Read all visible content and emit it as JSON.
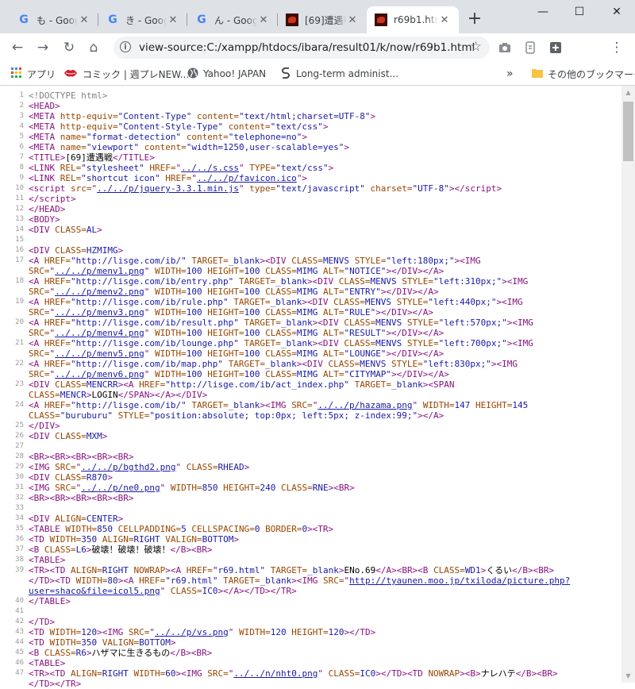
{
  "tabs": [
    {
      "title": "も - Google",
      "icon": "google-icon"
    },
    {
      "title": "き - Google",
      "icon": "google-icon"
    },
    {
      "title": "ん - Google",
      "icon": "google-icon"
    },
    {
      "title": "[69]遭遇戦",
      "icon": "site-favicon-icon"
    },
    {
      "title": "r69b1.html",
      "icon": "site-favicon-icon",
      "active": true
    }
  ],
  "toolbar": {
    "url": "view-source:C:/xampp/htdocs/ibara/result01/k/now/r69b1.html",
    "profile_initial": "S"
  },
  "bookmarks": {
    "items": [
      {
        "label": "アプリ",
        "icon": "apps-grid-icon"
      },
      {
        "label": "コミック | 週プレNEW...",
        "icon": "lips-icon"
      },
      {
        "label": "Yahoo! JAPAN",
        "icon": "globe-icon"
      },
      {
        "label": "Long-term administ...",
        "icon": "script-icon"
      }
    ],
    "other_label": "その他のブックマーク"
  },
  "source_lines": [
    {
      "n": "1",
      "html": "<span class=\"c\">&lt;!DOCTYPE html&gt;</span>"
    },
    {
      "n": "2",
      "html": "<span class=\"t\">&lt;HEAD&gt;</span>"
    },
    {
      "n": "3",
      "html": "<span class=\"t\">&lt;META <span class=\"a\">http-equiv=</span><span class=\"v\">\"Content-Type\"</span> <span class=\"a\">content=</span><span class=\"v\">\"text/html;charset=UTF-8\"</span>&gt;</span>"
    },
    {
      "n": "4",
      "html": "<span class=\"t\">&lt;META <span class=\"a\">http-equiv=</span><span class=\"v\">\"Content-Style-Type\"</span> <span class=\"a\">content=</span><span class=\"v\">\"text/css\"</span>&gt;</span>"
    },
    {
      "n": "5",
      "html": "<span class=\"t\">&lt;META <span class=\"a\">name=</span><span class=\"v\">\"format-detection\"</span> <span class=\"a\">content=</span><span class=\"v\">\"telephone=no\"</span>&gt;</span>"
    },
    {
      "n": "6",
      "html": "<span class=\"t\">&lt;META <span class=\"a\">name=</span><span class=\"v\">\"viewport\"</span> <span class=\"a\">content=</span><span class=\"v\">\"width=1250,user-scalable=yes\"</span>&gt;</span>"
    },
    {
      "n": "7",
      "html": "<span class=\"t\">&lt;TITLE&gt;</span>[69]遭遇戦<span class=\"t\">&lt;/TITLE&gt;</span>"
    },
    {
      "n": "8",
      "html": "<span class=\"t\">&lt;LINK <span class=\"a\">REL=</span><span class=\"v\">\"stylesheet\"</span> <span class=\"a\">HREF=</span>\"<span class=\"k\">../../s.css</span>\" <span class=\"a\">TYPE=</span><span class=\"v\">\"text/css\"</span>&gt;</span>"
    },
    {
      "n": "9",
      "html": "<span class=\"t\">&lt;LINK <span class=\"a\">REL=</span><span class=\"v\">\"shortcut icon\"</span> <span class=\"a\">HREF=</span>\"<span class=\"k\">../../p/favicon.ico</span>\"&gt;</span>"
    },
    {
      "n": "10",
      "html": "<span class=\"t\">&lt;script <span class=\"a\">src=</span>\"<span class=\"k\">../../p/jquery-3.3.1.min.js</span>\" <span class=\"a\">type=</span><span class=\"v\">\"text/javascript\"</span> <span class=\"a\">charset=</span><span class=\"v\">\"UTF-8\"</span>&gt;&lt;/script&gt;</span>"
    },
    {
      "n": "11",
      "html": "<span class=\"t\">&lt;/script&gt;</span>"
    },
    {
      "n": "12",
      "html": "<span class=\"t\">&lt;/HEAD&gt;</span>"
    },
    {
      "n": "13",
      "html": "<span class=\"t\">&lt;BODY&gt;</span>"
    },
    {
      "n": "14",
      "html": "<span class=\"t\">&lt;DIV <span class=\"a\">CLASS=</span><span class=\"v\">AL</span>&gt;</span>"
    },
    {
      "n": "15",
      "html": ""
    },
    {
      "n": "16",
      "html": "<span class=\"t\">&lt;DIV <span class=\"a\">CLASS=</span><span class=\"v\">HZMIMG</span>&gt;</span>"
    },
    {
      "n": "17",
      "html": "<span class=\"t\">&lt;A <span class=\"a\">HREF=</span><span class=\"v\">\"http://lisge.com/ib/\"</span> <span class=\"a\">TARGET=</span><span class=\"v\">_blank</span>&gt;&lt;DIV <span class=\"a\">CLASS=</span><span class=\"v\">MENVS</span> <span class=\"a\">STYLE=</span><span class=\"v\">\"left:180px;\"</span>&gt;&lt;IMG</span>"
    },
    {
      "n": "",
      "html": "<span class=\"t\"><span class=\"a\">SRC=</span>\"<span class=\"k\">../../p/menv1.png</span>\" <span class=\"a\">WIDTH=</span><span class=\"v\">100</span> <span class=\"a\">HEIGHT=</span><span class=\"v\">100</span> <span class=\"a\">CLASS=</span><span class=\"v\">MIMG</span> <span class=\"a\">ALT=</span><span class=\"v\">\"NOTICE\"</span>&gt;&lt;/DIV&gt;&lt;/A&gt;</span>"
    },
    {
      "n": "18",
      "html": "<span class=\"t\">&lt;A <span class=\"a\">HREF=</span><span class=\"v\">\"http://lisge.com/ib/entry.php\"</span> <span class=\"a\">TARGET=</span><span class=\"v\">_blank</span>&gt;&lt;DIV <span class=\"a\">CLASS=</span><span class=\"v\">MENVS</span> <span class=\"a\">STYLE=</span><span class=\"v\">\"left:310px;\"</span>&gt;&lt;IMG</span>"
    },
    {
      "n": "",
      "html": "<span class=\"t\"><span class=\"a\">SRC=</span>\"<span class=\"k\">../../p/menv2.png</span>\" <span class=\"a\">WIDTH=</span><span class=\"v\">100</span> <span class=\"a\">HEIGHT=</span><span class=\"v\">100</span> <span class=\"a\">CLASS=</span><span class=\"v\">MIMG</span> <span class=\"a\">ALT=</span><span class=\"v\">\"ENTRY\"</span>&gt;&lt;/DIV&gt;&lt;/A&gt;</span>"
    },
    {
      "n": "19",
      "html": "<span class=\"t\">&lt;A <span class=\"a\">HREF=</span><span class=\"v\">\"http://lisge.com/ib/rule.php\"</span> <span class=\"a\">TARGET=</span><span class=\"v\">_blank</span>&gt;&lt;DIV <span class=\"a\">CLASS=</span><span class=\"v\">MENVS</span> <span class=\"a\">STYLE=</span><span class=\"v\">\"left:440px;\"</span>&gt;&lt;IMG</span>"
    },
    {
      "n": "",
      "html": "<span class=\"t\"><span class=\"a\">SRC=</span>\"<span class=\"k\">../../p/menv3.png</span>\" <span class=\"a\">WIDTH=</span><span class=\"v\">100</span> <span class=\"a\">HEIGHT=</span><span class=\"v\">100</span> <span class=\"a\">CLASS=</span><span class=\"v\">MIMG</span> <span class=\"a\">ALT=</span><span class=\"v\">\"RULE\"</span>&gt;&lt;/DIV&gt;&lt;/A&gt;</span>"
    },
    {
      "n": "20",
      "html": "<span class=\"t\">&lt;A <span class=\"a\">HREF=</span><span class=\"v\">\"http://lisge.com/ib/result.php\"</span> <span class=\"a\">TARGET=</span><span class=\"v\">_blank</span>&gt;&lt;DIV <span class=\"a\">CLASS=</span><span class=\"v\">MENVS</span> <span class=\"a\">STYLE=</span><span class=\"v\">\"left:570px;\"</span>&gt;&lt;IMG</span>"
    },
    {
      "n": "",
      "html": "<span class=\"t\"><span class=\"a\">SRC=</span>\"<span class=\"k\">../../p/menv4.png</span>\" <span class=\"a\">WIDTH=</span><span class=\"v\">100</span> <span class=\"a\">HEIGHT=</span><span class=\"v\">100</span> <span class=\"a\">CLASS=</span><span class=\"v\">MIMG</span> <span class=\"a\">ALT=</span><span class=\"v\">\"RESULT\"</span>&gt;&lt;/DIV&gt;&lt;/A&gt;</span>"
    },
    {
      "n": "21",
      "html": "<span class=\"t\">&lt;A <span class=\"a\">HREF=</span><span class=\"v\">\"http://lisge.com/ib/lounge.php\"</span> <span class=\"a\">TARGET=</span><span class=\"v\">_blank</span>&gt;&lt;DIV <span class=\"a\">CLASS=</span><span class=\"v\">MENVS</span> <span class=\"a\">STYLE=</span><span class=\"v\">\"left:700px;\"</span>&gt;&lt;IMG</span>"
    },
    {
      "n": "",
      "html": "<span class=\"t\"><span class=\"a\">SRC=</span>\"<span class=\"k\">../../p/menv5.png</span>\" <span class=\"a\">WIDTH=</span><span class=\"v\">100</span> <span class=\"a\">HEIGHT=</span><span class=\"v\">100</span> <span class=\"a\">CLASS=</span><span class=\"v\">MIMG</span> <span class=\"a\">ALT=</span><span class=\"v\">\"LOUNGE\"</span>&gt;&lt;/DIV&gt;&lt;/A&gt;</span>"
    },
    {
      "n": "22",
      "html": "<span class=\"t\">&lt;A <span class=\"a\">HREF=</span><span class=\"v\">\"http://lisge.com/ib/map.php\"</span> <span class=\"a\">TARGET=</span><span class=\"v\">_blank</span>&gt;&lt;DIV <span class=\"a\">CLASS=</span><span class=\"v\">MENVS</span> <span class=\"a\">STYLE=</span><span class=\"v\">\"left:830px;\"</span>&gt;&lt;IMG</span>"
    },
    {
      "n": "",
      "html": "<span class=\"t\"><span class=\"a\">SRC=</span>\"<span class=\"k\">../../p/menv6.png</span>\" <span class=\"a\">WIDTH=</span><span class=\"v\">100</span> <span class=\"a\">HEIGHT=</span><span class=\"v\">100</span> <span class=\"a\">CLASS=</span><span class=\"v\">MIMG</span> <span class=\"a\">ALT=</span><span class=\"v\">\"CITYMAP\"</span>&gt;&lt;/DIV&gt;&lt;/A&gt;</span>"
    },
    {
      "n": "23",
      "html": "<span class=\"t\">&lt;DIV <span class=\"a\">CLASS=</span><span class=\"v\">MENCRR</span>&gt;&lt;A <span class=\"a\">HREF=</span><span class=\"v\">\"http://lisge.com/ib/act_index.php\"</span> <span class=\"a\">TARGET=</span><span class=\"v\">_blank</span>&gt;&lt;SPAN</span>"
    },
    {
      "n": "",
      "html": "<span class=\"t\"><span class=\"a\">CLASS=</span><span class=\"v\">MENCR</span>&gt;</span>LOGIN<span class=\"t\">&lt;/SPAN&gt;&lt;/A&gt;&lt;/DIV&gt;</span>"
    },
    {
      "n": "24",
      "html": "<span class=\"t\">&lt;A <span class=\"a\">HREF=</span><span class=\"v\">\"http://lisge.com/ib/\"</span> <span class=\"a\">TARGET=</span><span class=\"v\">_blank</span>&gt;&lt;IMG <span class=\"a\">SRC=</span>\"<span class=\"k\">../../p/hazama.png</span>\" <span class=\"a\">WIDTH=</span><span class=\"v\">147</span> <span class=\"a\">HEIGHT=</span><span class=\"v\">145</span></span>"
    },
    {
      "n": "",
      "html": "<span class=\"t\"><span class=\"a\">CLASS=</span><span class=\"v\">\"buruburu\"</span> <span class=\"a\">STYLE=</span><span class=\"v\">\"position:absolute; top:0px; left:5px; z-index:99;\"</span>&gt;&lt;/A&gt;</span>"
    },
    {
      "n": "25",
      "html": "<span class=\"t\">&lt;/DIV&gt;</span>"
    },
    {
      "n": "26",
      "html": "<span class=\"t\">&lt;DIV <span class=\"a\">CLASS=</span><span class=\"v\">MXM</span>&gt;</span>"
    },
    {
      "n": "27",
      "html": ""
    },
    {
      "n": "28",
      "html": "<span class=\"t\">&lt;BR&gt;&lt;BR&gt;&lt;BR&gt;&lt;BR&gt;&lt;BR&gt;</span>"
    },
    {
      "n": "29",
      "html": "<span class=\"t\">&lt;IMG <span class=\"a\">SRC=</span>\"<span class=\"k\">../../p/bgthd2.png</span>\" <span class=\"a\">CLASS=</span><span class=\"v\">RHEAD</span>&gt;</span>"
    },
    {
      "n": "30",
      "html": "<span class=\"t\">&lt;DIV <span class=\"a\">CLASS=</span><span class=\"v\">R870</span>&gt;</span>"
    },
    {
      "n": "31",
      "html": "<span class=\"t\">&lt;IMG <span class=\"a\">SRC=</span>\"<span class=\"k\">../../p/ne0.png</span>\" <span class=\"a\">WIDTH=</span><span class=\"v\">850</span> <span class=\"a\">HEIGHT=</span><span class=\"v\">240</span> <span class=\"a\">CLASS=</span><span class=\"v\">RNE</span>&gt;&lt;BR&gt;</span>"
    },
    {
      "n": "32",
      "html": "<span class=\"t\">&lt;BR&gt;&lt;BR&gt;&lt;BR&gt;&lt;BR&gt;&lt;BR&gt;</span>"
    },
    {
      "n": "33",
      "html": ""
    },
    {
      "n": "34",
      "html": "<span class=\"t\">&lt;DIV <span class=\"a\">ALIGN=</span><span class=\"v\">CENTER</span>&gt;</span>"
    },
    {
      "n": "35",
      "html": "<span class=\"t\">&lt;TABLE <span class=\"a\">WIDTH=</span><span class=\"v\">850</span> <span class=\"a\">CELLPADDING=</span><span class=\"v\">5</span> <span class=\"a\">CELLSPACING=</span><span class=\"v\">0</span> <span class=\"a\">BORDER=</span><span class=\"v\">0</span>&gt;&lt;TR&gt;</span>"
    },
    {
      "n": "36",
      "html": "<span class=\"t\">&lt;TD <span class=\"a\">WIDTH=</span><span class=\"v\">350</span> <span class=\"a\">ALIGN=</span><span class=\"v\">RIGHT</span> <span class=\"a\">VALIGN=</span><span class=\"v\">BOTTOM</span>&gt;</span>"
    },
    {
      "n": "37",
      "html": "<span class=\"t\">&lt;B <span class=\"a\">CLASS=</span><span class=\"v\">L6</span>&gt;</span>破壊！破壊！破壊！<span class=\"t\">&lt;/B&gt;&lt;BR&gt;</span>"
    },
    {
      "n": "38",
      "html": "<span class=\"t\">&lt;TABLE&gt;</span>"
    },
    {
      "n": "39",
      "html": "<span class=\"t\">&lt;TR&gt;&lt;TD <span class=\"a\">ALIGN=</span><span class=\"v\">RIGHT</span> <span class=\"a\">NOWRAP</span>&gt;&lt;A <span class=\"a\">HREF=</span><span class=\"v\">\"r69.html\"</span> <span class=\"a\">TARGET=</span><span class=\"v\">_blank</span>&gt;</span>ENo.69<span class=\"t\">&lt;/A&gt;&lt;BR&gt;&lt;B <span class=\"a\">CLASS=</span><span class=\"v\">WD1</span>&gt;</span>くるい<span class=\"t\">&lt;/B&gt;&lt;BR&gt;</span>"
    },
    {
      "n": "",
      "html": "<span class=\"t\">&lt;/TD&gt;&lt;TD <span class=\"a\">WIDTH=</span><span class=\"v\">80</span>&gt;&lt;A <span class=\"a\">HREF=</span><span class=\"v\">\"r69.html\"</span> <span class=\"a\">TARGET=</span><span class=\"v\">_blank</span>&gt;&lt;IMG <span class=\"a\">SRC=</span>\"<span class=\"k\">http://tyaunen.moo.jp/txiloda/picture.php?</span></span>"
    },
    {
      "n": "",
      "html": "<span class=\"t\"><span class=\"k\">user=shaco&amp;file=icol5.png</span>\" <span class=\"a\">CLASS=</span><span class=\"v\">IC0</span>&gt;&lt;/A&gt;&lt;/TD&gt;&lt;/TR&gt;</span>"
    },
    {
      "n": "40",
      "html": "<span class=\"t\">&lt;/TABLE&gt;</span>"
    },
    {
      "n": "41",
      "html": ""
    },
    {
      "n": "42",
      "html": "<span class=\"t\">&lt;/TD&gt;</span>"
    },
    {
      "n": "43",
      "html": "<span class=\"t\">&lt;TD <span class=\"a\">WIDTH=</span><span class=\"v\">120</span>&gt;&lt;IMG <span class=\"a\">SRC=</span>\"<span class=\"k\">../../p/vs.png</span>\" <span class=\"a\">WIDTH=</span><span class=\"v\">120</span> <span class=\"a\">HEIGHT=</span><span class=\"v\">120</span>&gt;&lt;/TD&gt;</span>"
    },
    {
      "n": "44",
      "html": "<span class=\"t\">&lt;TD <span class=\"a\">WIDTH=</span><span class=\"v\">350</span> <span class=\"a\">VALIGN=</span><span class=\"v\">BOTTOM</span>&gt;</span>"
    },
    {
      "n": "45",
      "html": "<span class=\"t\">&lt;B <span class=\"a\">CLASS=</span><span class=\"v\">R6</span>&gt;</span>ハザマに生きるもの<span class=\"t\">&lt;/B&gt;&lt;BR&gt;</span>"
    },
    {
      "n": "46",
      "html": "<span class=\"t\">&lt;TABLE&gt;</span>"
    },
    {
      "n": "47",
      "html": "<span class=\"t\">&lt;TR&gt;&lt;TD <span class=\"a\">ALIGN=</span><span class=\"v\">RIGHT</span> <span class=\"a\">WIDTH=</span><span class=\"v\">60</span>&gt;&lt;IMG <span class=\"a\">SRC=</span>\"<span class=\"k\">../../n/nht0.png</span>\" <span class=\"a\">CLASS=</span><span class=\"v\">IC0</span>&gt;&lt;/TD&gt;&lt;TD <span class=\"a\">NOWRAP</span>&gt;&lt;B&gt;</span>ナレハテ<span class=\"t\">&lt;/B&gt;&lt;BR&gt;</span>"
    },
    {
      "n": "",
      "html": "<span class=\"t\">&lt;/TD&gt;&lt;/TR&gt;</span>"
    }
  ]
}
